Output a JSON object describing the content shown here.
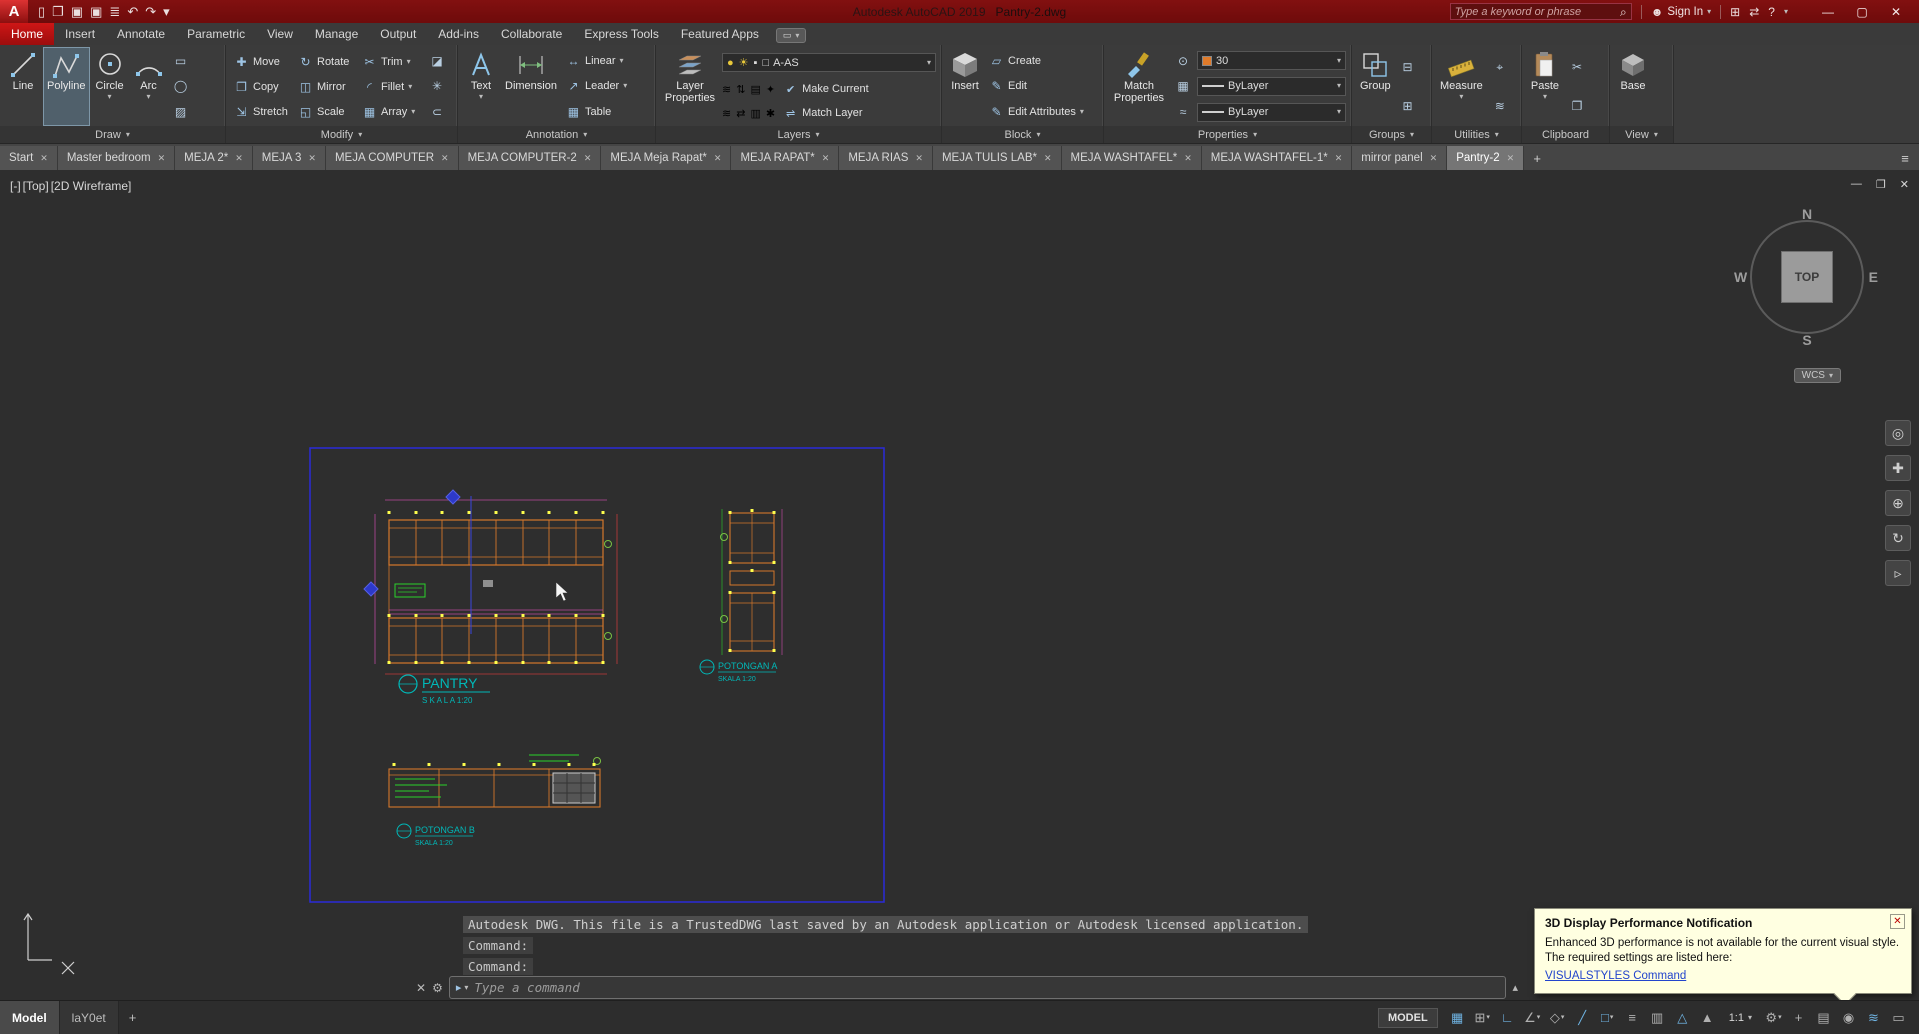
{
  "glyphs": {
    "close": "✕",
    "caret": "▾",
    "caret_up": "▴",
    "plus": "+",
    "menu": "≡",
    "minimize": "—",
    "maximize": "▢",
    "restore": "❐",
    "prompt": "▸",
    "wrench": "⚙",
    "search": "⌕",
    "person": "☻",
    "cart": "⊞",
    "exchange": "⇄",
    "help": "?",
    "panelbar": "▭"
  },
  "titlebar": {
    "app_button": "A",
    "app_title": "Autodesk AutoCAD 2019",
    "doc_title": "Pantry-2.dwg",
    "search_placeholder": "Type a keyword or phrase",
    "sign_in_label": "Sign In",
    "qat_icons": [
      {
        "name": "new-file-icon",
        "glyph": "▯"
      },
      {
        "name": "open-file-icon",
        "glyph": "❐"
      },
      {
        "name": "save-icon",
        "glyph": "▣"
      },
      {
        "name": "save-as-icon",
        "glyph": "▣"
      },
      {
        "name": "plot-icon",
        "glyph": "≣"
      },
      {
        "name": "undo-icon",
        "glyph": "↶"
      },
      {
        "name": "redo-icon",
        "glyph": "↷"
      },
      {
        "name": "qat-customize-icon",
        "glyph": "▾"
      }
    ]
  },
  "ribbon": {
    "tabs": [
      {
        "label": "Home",
        "active": true
      },
      {
        "label": "Insert"
      },
      {
        "label": "Annotate"
      },
      {
        "label": "Parametric"
      },
      {
        "label": "View"
      },
      {
        "label": "Manage"
      },
      {
        "label": "Output"
      },
      {
        "label": "Add-ins"
      },
      {
        "label": "Collaborate"
      },
      {
        "label": "Express Tools"
      },
      {
        "label": "Featured Apps"
      }
    ],
    "panels": {
      "draw": {
        "title": "Draw",
        "line_label": "Line",
        "polyline_label": "Polyline",
        "circle_label": "Circle",
        "arc_label": "Arc",
        "extra_icons": [
          {
            "name": "rectangle-tool-icon",
            "glyph": "▭"
          },
          {
            "name": "ellipse-tool-icon",
            "glyph": "◯"
          },
          {
            "name": "hatch-tool-icon",
            "glyph": "▨"
          }
        ]
      },
      "modify": {
        "title": "Modify",
        "tools": [
          {
            "name": "move",
            "label": "Move",
            "glyph": "✚"
          },
          {
            "name": "rotate",
            "label": "Rotate",
            "glyph": "↻"
          },
          {
            "name": "trim",
            "label": "Trim",
            "glyph": "✂",
            "dropdown": true
          },
          {
            "name": "copy",
            "label": "Copy",
            "glyph": "❐"
          },
          {
            "name": "mirror",
            "label": "Mirror",
            "glyph": "◫"
          },
          {
            "name": "fillet",
            "label": "Fillet",
            "glyph": "◜",
            "dropdown": true
          },
          {
            "name": "stretch",
            "label": "Stretch",
            "glyph": "⇲"
          },
          {
            "name": "scale",
            "label": "Scale",
            "glyph": "◱"
          },
          {
            "name": "array",
            "label": "Array",
            "glyph": "▦",
            "dropdown": true
          }
        ],
        "extra_tools": [
          {
            "name": "erase-tool-icon",
            "glyph": "◪"
          },
          {
            "name": "explode-tool-icon",
            "glyph": "✳"
          },
          {
            "name": "offset-tool-icon",
            "glyph": "⊂"
          }
        ]
      },
      "annotation": {
        "title": "Annotation",
        "text_label": "Text",
        "dimension_label": "Dimension",
        "tools": [
          {
            "name": "linear",
            "label": "Linear",
            "glyph": "↔",
            "dropdown": true
          },
          {
            "name": "leader",
            "label": "Leader",
            "glyph": "↗",
            "dropdown": true
          },
          {
            "name": "table",
            "label": "Table",
            "glyph": "▦"
          }
        ]
      },
      "layers": {
        "title": "Layers",
        "big_label": "Layer Properties",
        "current_layer": "A-AS",
        "make_current": "Make Current",
        "match_layer": "Match Layer",
        "dropdown_icons": [
          "●",
          "☀",
          "▪",
          "□"
        ],
        "row2_icons": [
          "≋",
          "⇅",
          "▤",
          "✦"
        ],
        "row3_icons": [
          "≋",
          "⇄",
          "▥",
          "✱"
        ],
        "make_current_glyph": "✔",
        "match_layer_glyph": "⇌"
      },
      "block": {
        "title": "Block",
        "big_label": "Insert",
        "tools": [
          {
            "name": "create-block",
            "label": "Create",
            "glyph": "▱"
          },
          {
            "name": "edit-block",
            "label": "Edit",
            "glyph": "✎"
          },
          {
            "name": "edit-attributes",
            "label": "Edit Attributes",
            "glyph": "✎",
            "dropdown": true
          }
        ]
      },
      "properties": {
        "title": "Properties",
        "big_label": "Match Properties",
        "transparency_value": "30",
        "color_value": "ByLayer",
        "lineweight_value": "ByLayer",
        "side_icons": [
          "⊙",
          "▦",
          "≈"
        ]
      },
      "groups": {
        "title": "Groups",
        "big_label": "Group",
        "side_icons": [
          "⊟",
          "⊞"
        ]
      },
      "utilities": {
        "title": "Utilities",
        "big_label": "Measure",
        "side_icons": [
          "⌖",
          "≋"
        ]
      },
      "clipboard": {
        "title": "Clipboard",
        "big_label": "Paste",
        "side_icons": [
          "✂",
          "❐"
        ]
      },
      "view": {
        "title": "View",
        "big_label": "Base"
      }
    }
  },
  "file_tabs": [
    {
      "label": "Start"
    },
    {
      "label": "Master bedroom"
    },
    {
      "label": "MEJA 2*"
    },
    {
      "label": "MEJA 3"
    },
    {
      "label": "MEJA COMPUTER"
    },
    {
      "label": "MEJA COMPUTER-2"
    },
    {
      "label": "MEJA Meja Rapat*"
    },
    {
      "label": "MEJA RAPAT*"
    },
    {
      "label": "MEJA RIAS"
    },
    {
      "label": "MEJA TULIS LAB*"
    },
    {
      "label": "MEJA WASHTAFEL*"
    },
    {
      "label": "MEJA WASHTAFEL-1*"
    },
    {
      "label": "mirror panel"
    },
    {
      "label": "Pantry-2",
      "active": true
    }
  ],
  "viewport": {
    "pane": "[-]",
    "view": "[Top]",
    "visual": "[2D Wireframe]",
    "viewcube": {
      "north": "N",
      "west": "W",
      "east": "E",
      "south": "S",
      "top": "TOP",
      "wcs": "WCS"
    }
  },
  "navbar_icons": [
    {
      "name": "steering-wheel-icon",
      "glyph": "◎"
    },
    {
      "name": "pan-icon",
      "glyph": "✚"
    },
    {
      "name": "zoom-icon",
      "glyph": "⊕"
    },
    {
      "name": "orbit-icon",
      "glyph": "↻"
    },
    {
      "name": "showmotion-icon",
      "glyph": "▹"
    }
  ],
  "drawing": {
    "pantry_title": "PANTRY",
    "pantry_scale": "S K A L A   1:20",
    "potongan_a_title": "POTONGAN A",
    "potongan_a_scale": "SKALA 1:20",
    "potongan_b_title": "POTONGAN B",
    "potongan_b_scale": "SKALA 1:20"
  },
  "command": {
    "trust_message": "Autodesk DWG.  This file is a TrustedDWG last saved by an Autodesk application or Autodesk licensed application.",
    "history": [
      "Command:",
      "Command:"
    ],
    "prompt_placeholder": "Type a command"
  },
  "notification": {
    "title": "3D Display Performance Notification",
    "line1": "Enhanced 3D performance is not available for the current visual style.",
    "line2": "The required settings are listed here:",
    "link_label": "VISUALSTYLES Command"
  },
  "statusbar": {
    "model_tab": "Model",
    "layout_tab": "laY0et",
    "model_button": "MODEL",
    "scale_value": "1:1",
    "icons_a": [
      {
        "name": "grid-display-icon",
        "glyph": "▦",
        "active": true
      },
      {
        "name": "snap-mode-icon",
        "glyph": "⊞",
        "caret": true
      },
      {
        "name": "ortho-mode-icon",
        "glyph": "∟",
        "active": true
      },
      {
        "name": "polar-tracking-icon",
        "glyph": "∠",
        "caret": true
      },
      {
        "name": "isodraft-icon",
        "glyph": "◇",
        "caret": true
      },
      {
        "name": "object-snap-tracking-icon",
        "glyph": "╱",
        "active": true
      },
      {
        "name": "object-snap-icon",
        "glyph": "□",
        "active": true,
        "caret": true
      },
      {
        "name": "lineweight-icon",
        "glyph": "≡"
      },
      {
        "name": "selection-cycling-icon",
        "glyph": "▥"
      },
      {
        "name": "annotation-visibility-icon",
        "glyph": "△",
        "active": true
      },
      {
        "name": "autoscale-icon",
        "glyph": "▲"
      }
    ],
    "icons_b": [
      {
        "name": "workspace-gear-icon",
        "glyph": "⚙",
        "caret": true
      },
      {
        "name": "annotation-monitor-icon",
        "glyph": "+"
      },
      {
        "name": "quick-properties-icon",
        "glyph": "▤"
      },
      {
        "name": "isolate-objects-icon",
        "glyph": "◉"
      },
      {
        "name": "graphics-performance-icon",
        "glyph": "≋",
        "active": true
      },
      {
        "name": "clean-screen-icon",
        "glyph": "▭"
      }
    ]
  }
}
